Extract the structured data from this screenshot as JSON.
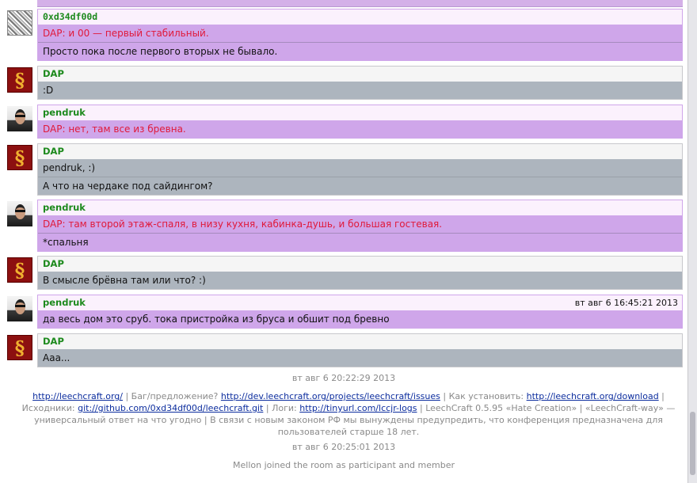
{
  "messages": [
    {
      "nick": "0xd34df00d",
      "avatar": "pixel-avatar",
      "timestamp": "",
      "lines": [
        {
          "text": "DAP: и 00 — первый стабильный.",
          "highlight": true
        },
        {
          "text": "Просто пока после первого вторых не бывало.",
          "highlight": false
        }
      ]
    },
    {
      "nick": "DAP",
      "avatar": "dap-logo-avatar",
      "timestamp": "",
      "lines": [
        {
          "text": ":D",
          "highlight": false
        }
      ]
    },
    {
      "nick": "pendruk",
      "avatar": "person-avatar",
      "timestamp": "",
      "lines": [
        {
          "text": "DAP: нет, там все из бревна.",
          "highlight": true
        }
      ]
    },
    {
      "nick": "DAP",
      "avatar": "dap-logo-avatar",
      "timestamp": "",
      "lines": [
        {
          "text": "pendruk, :)",
          "highlight": false
        },
        {
          "text": "А что на чердаке под сайдингом?",
          "highlight": false
        }
      ]
    },
    {
      "nick": "pendruk",
      "avatar": "person-avatar",
      "timestamp": "",
      "lines": [
        {
          "text": "DAP: там второй этаж-спаля, в низу кухня, кабинка-душь, и большая гостевая.",
          "highlight": true
        },
        {
          "text": "*спальня",
          "highlight": false
        }
      ]
    },
    {
      "nick": "DAP",
      "avatar": "dap-logo-avatar",
      "timestamp": "",
      "lines": [
        {
          "text": "В смысле брёвна там или что? :)",
          "highlight": false
        }
      ]
    },
    {
      "nick": "pendruk",
      "avatar": "person-avatar",
      "timestamp": "вт авг 6 16:45:21 2013",
      "lines": [
        {
          "text": "да весь дом это сруб. тока пристройка из бруса и обшит под бревно",
          "highlight": false
        }
      ]
    },
    {
      "nick": "DAP",
      "avatar": "dap-logo-avatar",
      "timestamp": "",
      "lines": [
        {
          "text": "Ааа...",
          "highlight": false
        }
      ]
    }
  ],
  "system": {
    "ts1": "вт авг 6 20:22:29 2013",
    "ts2": "вт авг 6 20:25:01 2013",
    "join": "Mellon joined the room as participant and member"
  },
  "topic": {
    "link_home": "http://leechcraft.org/",
    "text_bug": " | Баг/предложение? ",
    "link_issues": "http://dev.leechcraft.org/projects/leechcraft/issues",
    "text_install": " | Как установить: ",
    "link_download": "http://leechcraft.org/download",
    "text_sources": " | Исходники: ",
    "link_git": "git://github.com/0xd34df00d/leechcraft.git",
    "text_logs": " | Логи: ",
    "link_logs": "http://tinyurl.com/lccjr-logs",
    "text_tail": " | LeechCraft 0.5.95 «Hate Creation» | «LeechCraft-way» — универсальный ответ на что угодно | В связи с новым законом РФ мы вынуждены предупредить, что конференция предназначена для пользователей старше 18 лет."
  },
  "colors": {
    "own_bubble": "#cfa6ea",
    "other_bubble": "#adb5be",
    "nick": "#1d8a1d",
    "highlight": "#e0193a",
    "link": "#0c2d9e"
  }
}
